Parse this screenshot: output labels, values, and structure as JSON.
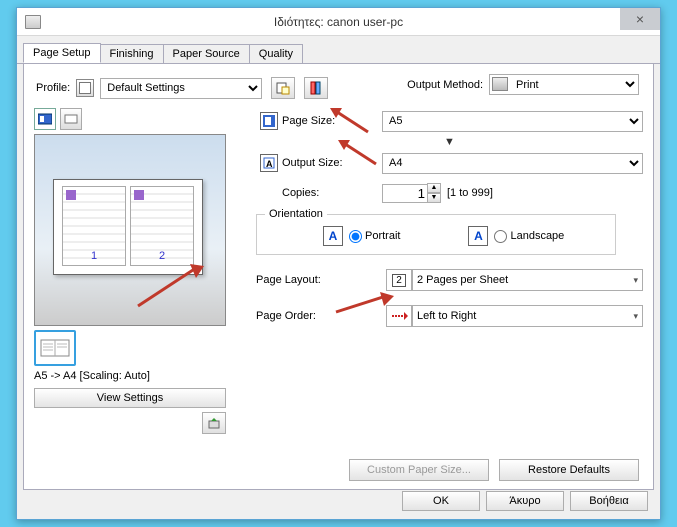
{
  "window": {
    "title": "Ιδιότητες: canon user-pc",
    "close": "×"
  },
  "tabs": {
    "page_setup": "Page Setup",
    "finishing": "Finishing",
    "paper_source": "Paper Source",
    "quality": "Quality"
  },
  "profile": {
    "label": "Profile:",
    "value": "Default Settings"
  },
  "output_method": {
    "label": "Output Method:",
    "value": "Print"
  },
  "preview": {
    "page1_num": "1",
    "page2_num": "2",
    "status": "A5 -> A4 [Scaling: Auto]"
  },
  "buttons": {
    "view_settings": "View Settings",
    "custom_paper": "Custom Paper Size...",
    "restore_defaults": "Restore Defaults",
    "ok": "OK",
    "cancel": "Άκυρο",
    "help": "Βοήθεια"
  },
  "page_size": {
    "label": "Page Size:",
    "value": "A5"
  },
  "output_size": {
    "label": "Output Size:",
    "value": "A4"
  },
  "copies": {
    "label": "Copies:",
    "value": "1",
    "range": "[1 to 999]"
  },
  "orientation": {
    "legend": "Orientation",
    "portrait": "Portrait",
    "landscape": "Landscape",
    "a": "A"
  },
  "page_layout": {
    "label": "Page Layout:",
    "value": "2 Pages per Sheet",
    "icon_num": "2"
  },
  "page_order": {
    "label": "Page Order:",
    "value": "Left to Right"
  }
}
